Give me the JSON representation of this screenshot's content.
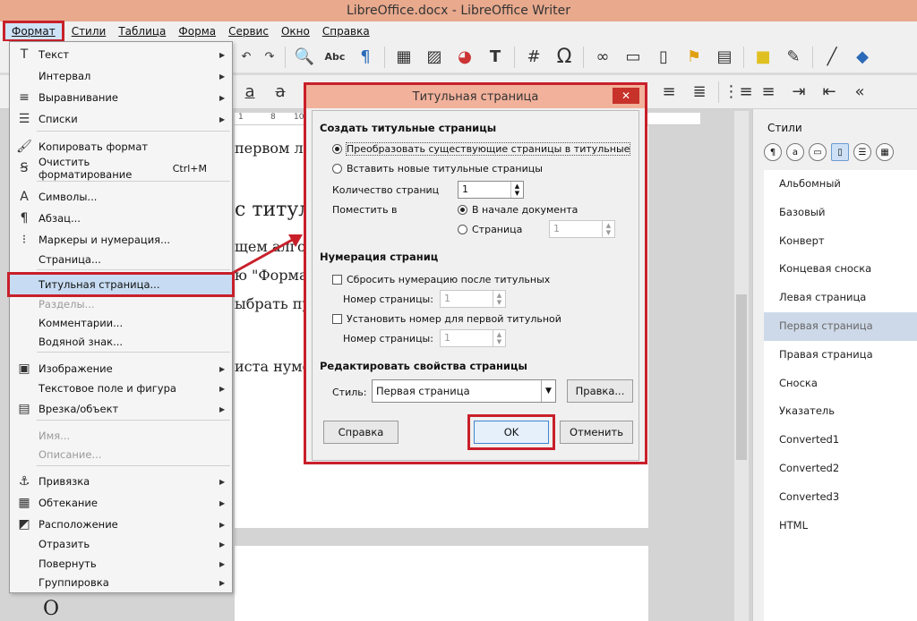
{
  "window": {
    "title": "LibreOffice.docx - LibreOffice Writer"
  },
  "menubar": [
    "Формат",
    "Стили",
    "Таблица",
    "Форма",
    "Сервис",
    "Окно",
    "Справка"
  ],
  "document": {
    "lines": [
      "первом л",
      "с титул",
      "щем алго",
      "ю \"Форма",
      "ыбрать пу",
      "иста нумер",
      "О"
    ]
  },
  "sidebar": {
    "title": "Стили",
    "items": [
      "Альбомный",
      "Базовый",
      "Конверт",
      "Концевая сноска",
      "Левая страница",
      "Первая страница",
      "Правая страница",
      "Сноска",
      "Указатель",
      "Converted1",
      "Converted2",
      "Converted3",
      "HTML"
    ],
    "selected_index": 5
  },
  "menu": {
    "items": [
      {
        "label": "Текст",
        "icon": "T",
        "arrow": "▶"
      },
      {
        "label": "Интервал",
        "icon": "",
        "arrow": "▶"
      },
      {
        "label": "Выравнивание",
        "icon": "≡",
        "arrow": "▶"
      },
      {
        "label": "Списки",
        "icon": "☰",
        "arrow": "▶"
      },
      {
        "label": "Копировать формат",
        "icon": "🖌"
      },
      {
        "label": "Очистить форматирование",
        "shortcut": "Ctrl+M",
        "icon": "Ꞩ"
      },
      {
        "label": "Символы...",
        "icon": "A"
      },
      {
        "label": "Абзац...",
        "icon": "¶"
      },
      {
        "label": "Маркеры и нумерация...",
        "icon": "⁝"
      },
      {
        "label": "Страница...",
        "icon": ""
      },
      {
        "label": "Титульная страница...",
        "icon": ""
      },
      {
        "label": "Разделы...",
        "icon": ""
      },
      {
        "label": "Комментарии...",
        "icon": ""
      },
      {
        "label": "Водяной знак...",
        "icon": ""
      },
      {
        "label": "Изображение",
        "icon": "▣",
        "arrow": "▶"
      },
      {
        "label": "Текстовое поле и фигура",
        "icon": "",
        "arrow": "▶"
      },
      {
        "label": "Врезка/объект",
        "icon": "▤",
        "arrow": "▶"
      },
      {
        "label": "Имя...",
        "icon": ""
      },
      {
        "label": "Описание...",
        "icon": ""
      },
      {
        "label": "Привязка",
        "icon": "⚓",
        "arrow": "▶"
      },
      {
        "label": "Обтекание",
        "icon": "▦",
        "arrow": "▶"
      },
      {
        "label": "Расположение",
        "icon": "◩",
        "arrow": "▶"
      },
      {
        "label": "Отразить",
        "icon": "",
        "arrow": "▶"
      },
      {
        "label": "Повернуть",
        "icon": "",
        "arrow": "▶"
      },
      {
        "label": "Группировка",
        "icon": "",
        "arrow": "▶"
      }
    ]
  },
  "dialog": {
    "title": "Титульная страница",
    "close": "✕",
    "section_create": "Создать титульные страницы",
    "opt_convert": "Преобразовать существующие страницы в титульные",
    "opt_insert": "Вставить новые титульные страницы",
    "label_count": "Количество страниц",
    "count_value": "1",
    "label_place": "Поместить в",
    "opt_start": "В начале документа",
    "opt_page": "Страница",
    "page_value": "1",
    "section_numbering": "Нумерация страниц",
    "chk_reset": "Сбросить нумерацию после титульных",
    "label_pagenum1": "Номер страницы:",
    "pagenum1_value": "1",
    "chk_set": "Установить номер для первой титульной",
    "label_pagenum2": "Номер страницы:",
    "pagenum2_value": "1",
    "section_props": "Редактировать свойства страницы",
    "label_style": "Стиль:",
    "style_value": "Первая страница",
    "btn_edit": "Правка...",
    "btn_help": "Справка",
    "btn_ok": "OK",
    "btn_cancel": "Отменить"
  },
  "colors": {
    "highlight_red": "#c8202a",
    "titlebar": "#e8a98d"
  }
}
